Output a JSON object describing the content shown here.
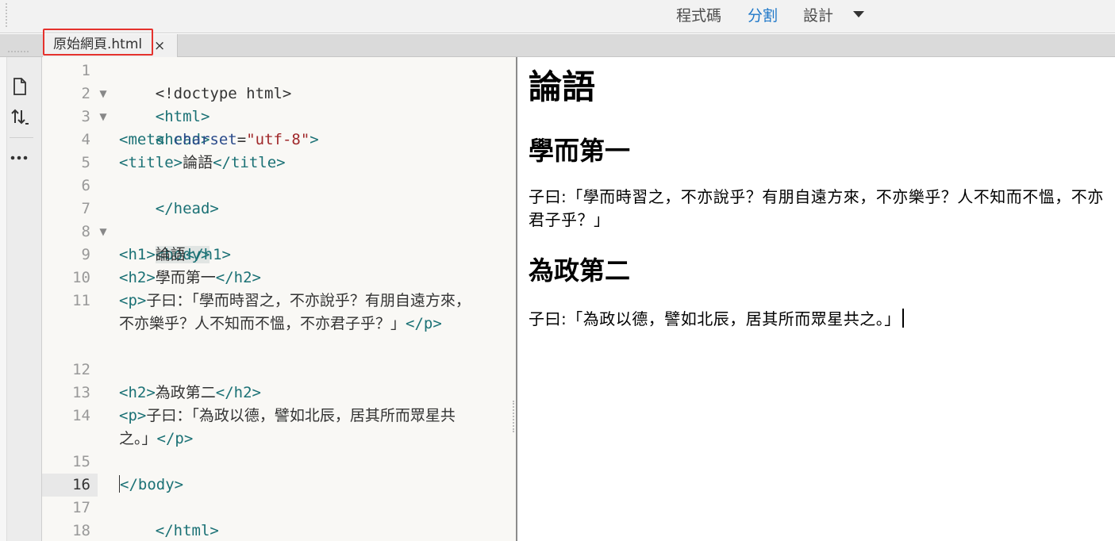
{
  "toolbar": {
    "view_code": "程式碼",
    "view_split": "分割",
    "view_design": "設計",
    "active_view": "分割"
  },
  "tab": {
    "filename": "原始網頁.html",
    "close": "×"
  },
  "sidebar": {
    "icons": [
      "file-icon",
      "sort-icon",
      "more-icon"
    ],
    "more_label": "•••"
  },
  "editor": {
    "current_line": 16,
    "line_numbers": [
      "1",
      "2",
      "3",
      "4",
      "5",
      "6",
      "7",
      "8",
      "9",
      "10",
      "11",
      "",
      "",
      "12",
      "13",
      "14",
      "",
      "15",
      "16",
      "17",
      "18"
    ],
    "lines": {
      "l1": "<!doctype html>",
      "l2": "<html>",
      "l3": "<head>",
      "l4_tag": "<meta",
      "l4_attr": "charset",
      "l4_eq": "=",
      "l4_val": "\"utf-8\"",
      "l4_end": ">",
      "l5_open": "<title>",
      "l5_text": "論語",
      "l5_close": "</title>",
      "l6": "</head>",
      "l8": "<body>",
      "l9_open": "<h1>",
      "l9_text": "論語",
      "l9_close": "</h1>",
      "l10_open": "<h2>",
      "l10_text": "學而第一",
      "l10_close": "</h2>",
      "l11_open": "<p>",
      "l11_text": "子曰：「學而時習之，不亦說乎？有朋自遠方來，不亦樂乎？人不知而不慍，不亦君子乎？」",
      "l11_close": "</p>",
      "l13_open": "<h2>",
      "l13_text": "為政第二",
      "l13_close": "</h2>",
      "l14_open": "<p>",
      "l14_text": "子曰：「為政以德，譬如北辰，居其所而眾星共之。」",
      "l14_close": "</p>",
      "l16_rest": "/body>",
      "l16_lt": "<",
      "l17": "</html>"
    },
    "fold_markers": [
      "▼",
      "▼",
      "▼"
    ]
  },
  "preview": {
    "h1": "論語",
    "h2_1": "學而第一",
    "p1": "子曰:「學而時習之，不亦說乎？有朋自遠方來，不亦樂乎？人不知而不慍，不亦君子乎？」",
    "h2_2": "為政第二",
    "p2": "子曰:「為政以德，譬如北辰，居其所而眾星共之。」"
  },
  "colors": {
    "tag": "#1b7175",
    "attribute": "#2a4a8a",
    "string": "#a0282a",
    "active_view": "#1f78c9",
    "tab_highlight": "#e5322d"
  }
}
